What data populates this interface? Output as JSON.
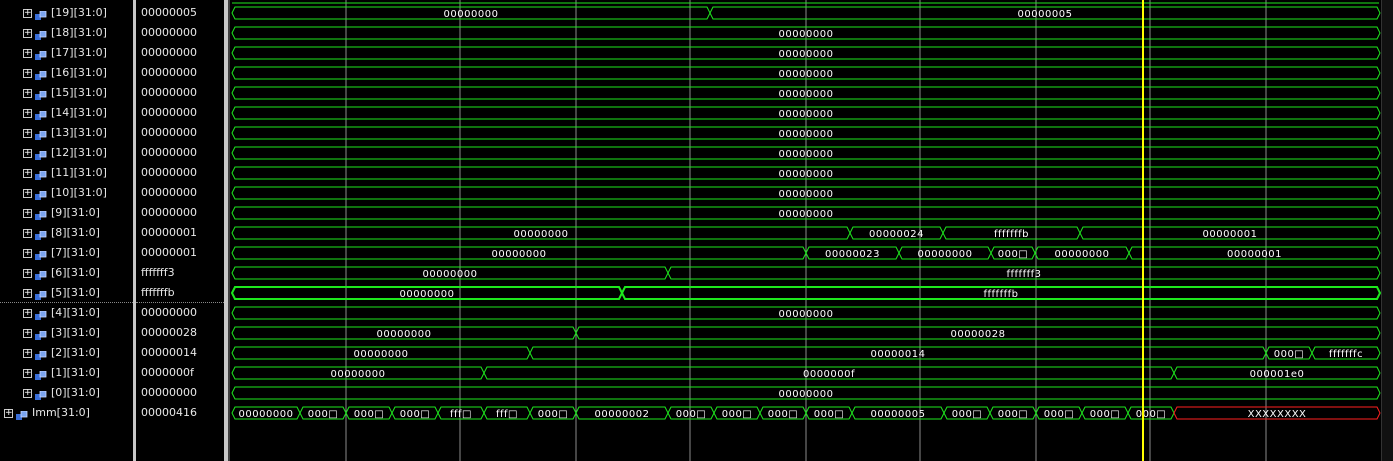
{
  "signals": [
    {
      "name": "[19][31:0]",
      "value": "00000005",
      "segs": [
        [
          0,
          480,
          "00000000"
        ],
        [
          480,
          1151,
          "00000005"
        ]
      ]
    },
    {
      "name": "[18][31:0]",
      "value": "00000000",
      "segs": [
        [
          0,
          1151,
          "00000000"
        ]
      ]
    },
    {
      "name": "[17][31:0]",
      "value": "00000000",
      "segs": [
        [
          0,
          1151,
          "00000000"
        ]
      ]
    },
    {
      "name": "[16][31:0]",
      "value": "00000000",
      "segs": [
        [
          0,
          1151,
          "00000000"
        ]
      ]
    },
    {
      "name": "[15][31:0]",
      "value": "00000000",
      "segs": [
        [
          0,
          1151,
          "00000000"
        ]
      ]
    },
    {
      "name": "[14][31:0]",
      "value": "00000000",
      "segs": [
        [
          0,
          1151,
          "00000000"
        ]
      ]
    },
    {
      "name": "[13][31:0]",
      "value": "00000000",
      "segs": [
        [
          0,
          1151,
          "00000000"
        ]
      ]
    },
    {
      "name": "[12][31:0]",
      "value": "00000000",
      "segs": [
        [
          0,
          1151,
          "00000000"
        ]
      ]
    },
    {
      "name": "[11][31:0]",
      "value": "00000000",
      "segs": [
        [
          0,
          1151,
          "00000000"
        ]
      ]
    },
    {
      "name": "[10][31:0]",
      "value": "00000000",
      "segs": [
        [
          0,
          1151,
          "00000000"
        ]
      ]
    },
    {
      "name": "[9][31:0]",
      "value": "00000000",
      "segs": [
        [
          0,
          1151,
          "00000000"
        ]
      ]
    },
    {
      "name": "[8][31:0]",
      "value": "00000001",
      "segs": [
        [
          0,
          620,
          "00000000"
        ],
        [
          620,
          713,
          "00000024"
        ],
        [
          713,
          850,
          "fffffffb"
        ],
        [
          850,
          1151,
          "00000001"
        ]
      ]
    },
    {
      "name": "[7][31:0]",
      "value": "00000001",
      "segs": [
        [
          0,
          576,
          "00000000"
        ],
        [
          576,
          669,
          "00000023"
        ],
        [
          669,
          761,
          "00000000"
        ],
        [
          761,
          805,
          "000□"
        ],
        [
          805,
          899,
          "00000000"
        ],
        [
          899,
          1151,
          "00000001"
        ]
      ]
    },
    {
      "name": "[6][31:0]",
      "value": "fffffff3",
      "segs": [
        [
          0,
          438,
          "00000000"
        ],
        [
          438,
          1151,
          "fffffff3"
        ]
      ]
    },
    {
      "name": "[5][31:0]",
      "value": "fffffffb",
      "selected": true,
      "segs": [
        [
          0,
          392,
          "00000000"
        ],
        [
          392,
          1151,
          "fffffffb"
        ]
      ]
    },
    {
      "name": "[4][31:0]",
      "value": "00000000",
      "segs": [
        [
          0,
          1151,
          "00000000"
        ]
      ]
    },
    {
      "name": "[3][31:0]",
      "value": "00000028",
      "segs": [
        [
          0,
          346,
          "00000000"
        ],
        [
          346,
          1151,
          "00000028"
        ]
      ]
    },
    {
      "name": "[2][31:0]",
      "value": "00000014",
      "segs": [
        [
          0,
          300,
          "00000000"
        ],
        [
          300,
          1036,
          "00000014"
        ],
        [
          1036,
          1082,
          "000□"
        ],
        [
          1082,
          1151,
          "fffffffc"
        ]
      ]
    },
    {
      "name": "[1][31:0]",
      "value": "0000000f",
      "segs": [
        [
          0,
          254,
          "00000000"
        ],
        [
          254,
          944,
          "0000000f"
        ],
        [
          944,
          1151,
          "000001e0"
        ]
      ]
    },
    {
      "name": "[0][31:0]",
      "value": "00000000",
      "segs": [
        [
          0,
          1151,
          "00000000"
        ]
      ]
    },
    {
      "name": "Imm[31:0]",
      "value": "00000416",
      "top": true,
      "segs": [
        [
          0,
          70,
          "00000000"
        ],
        [
          70,
          116,
          "000□"
        ],
        [
          116,
          162,
          "000□"
        ],
        [
          162,
          208,
          "000□"
        ],
        [
          208,
          254,
          "fff□"
        ],
        [
          254,
          300,
          "fff□"
        ],
        [
          300,
          346,
          "000□"
        ],
        [
          346,
          438,
          "00000002"
        ],
        [
          438,
          484,
          "000□"
        ],
        [
          484,
          530,
          "000□"
        ],
        [
          530,
          576,
          "000□"
        ],
        [
          576,
          622,
          "000□"
        ],
        [
          622,
          714,
          "00000005"
        ],
        [
          714,
          760,
          "000□"
        ],
        [
          760,
          806,
          "000□"
        ],
        [
          806,
          852,
          "000□"
        ],
        [
          852,
          898,
          "000□"
        ],
        [
          898,
          944,
          "000□"
        ],
        [
          944,
          1151,
          "XXXXXXXX",
          "red"
        ]
      ]
    }
  ],
  "colors": {
    "wave": "#1ee81e",
    "grid": "#8a8a8a",
    "cursor": "#ffff00",
    "undefined": "#ff2020"
  },
  "cursor_time_label": ""
}
